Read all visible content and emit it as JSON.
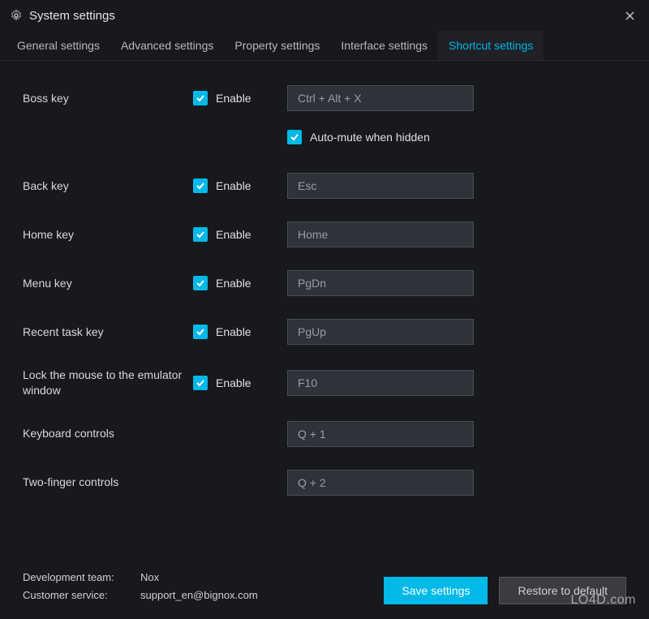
{
  "window": {
    "title": "System settings"
  },
  "tabs": [
    {
      "label": "General settings"
    },
    {
      "label": "Advanced settings"
    },
    {
      "label": "Property settings"
    },
    {
      "label": "Interface settings"
    },
    {
      "label": "Shortcut settings"
    }
  ],
  "shortcuts": {
    "boss": {
      "label": "Boss key",
      "enable": "Enable",
      "value": "Ctrl + Alt + X",
      "automute": "Auto-mute when hidden"
    },
    "back": {
      "label": "Back key",
      "enable": "Enable",
      "value": "Esc"
    },
    "home": {
      "label": "Home key",
      "enable": "Enable",
      "value": "Home"
    },
    "menu": {
      "label": "Menu key",
      "enable": "Enable",
      "value": "PgDn"
    },
    "recent": {
      "label": "Recent task key",
      "enable": "Enable",
      "value": "PgUp"
    },
    "lockmouse": {
      "label": "Lock the mouse to the emulator window",
      "enable": "Enable",
      "value": "F10"
    },
    "keyboard": {
      "label": "Keyboard controls",
      "value": "Q + 1"
    },
    "twofinger": {
      "label": "Two-finger controls",
      "value": "Q + 2"
    }
  },
  "footer": {
    "dev_label": "Development team:",
    "dev_value": "Nox",
    "support_label": "Customer service:",
    "support_value": "support_en@bignox.com",
    "save": "Save settings",
    "restore": "Restore to default"
  },
  "watermark": "LO4D.com"
}
